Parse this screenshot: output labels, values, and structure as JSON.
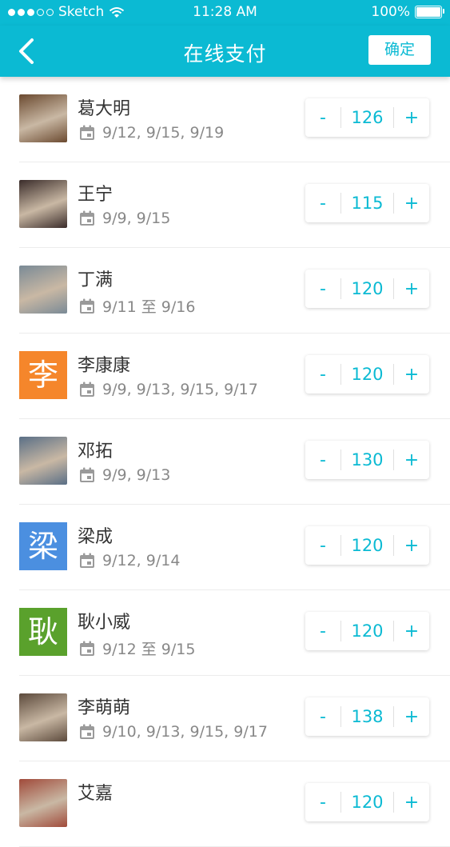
{
  "status_bar": {
    "carrier": "Sketch",
    "time": "11:28 AM",
    "battery": "100%"
  },
  "nav": {
    "title": "在线支付",
    "confirm_label": "确定"
  },
  "contacts": [
    {
      "name": "葛大明",
      "dates": "9/12, 9/15, 9/19",
      "value": "126",
      "avatar_type": "photo",
      "avatar_color": "#6b4a30"
    },
    {
      "name": "王宁",
      "dates": "9/9, 9/15",
      "value": "115",
      "avatar_type": "photo",
      "avatar_color": "#3a2c2a"
    },
    {
      "name": "丁满",
      "dates": "9/11 至 9/16",
      "value": "120",
      "avatar_type": "photo",
      "avatar_color": "#7a8a96"
    },
    {
      "name": "李康康",
      "dates": "9/9, 9/13, 9/15, 9/17",
      "value": "120",
      "avatar_type": "letter",
      "avatar_letter": "李",
      "avatar_color": "#f5862b"
    },
    {
      "name": "邓拓",
      "dates": "9/9, 9/13",
      "value": "130",
      "avatar_type": "photo",
      "avatar_color": "#5a6f86"
    },
    {
      "name": "梁成",
      "dates": "9/12, 9/14",
      "value": "120",
      "avatar_type": "letter",
      "avatar_letter": "梁",
      "avatar_color": "#4b8fe0"
    },
    {
      "name": "耿小威",
      "dates": "9/12 至 9/15",
      "value": "120",
      "avatar_type": "letter",
      "avatar_letter": "耿",
      "avatar_color": "#5aa12c"
    },
    {
      "name": "李萌萌",
      "dates": "9/10, 9/13, 9/15, 9/17",
      "value": "138",
      "avatar_type": "photo",
      "avatar_color": "#5c4a3c"
    },
    {
      "name": "艾嘉",
      "dates": "",
      "value": "120",
      "avatar_type": "photo",
      "avatar_color": "#a04a3a"
    }
  ],
  "stepper": {
    "minus_label": "-",
    "plus_label": "+"
  },
  "colors": {
    "accent": "#0bbad3"
  }
}
